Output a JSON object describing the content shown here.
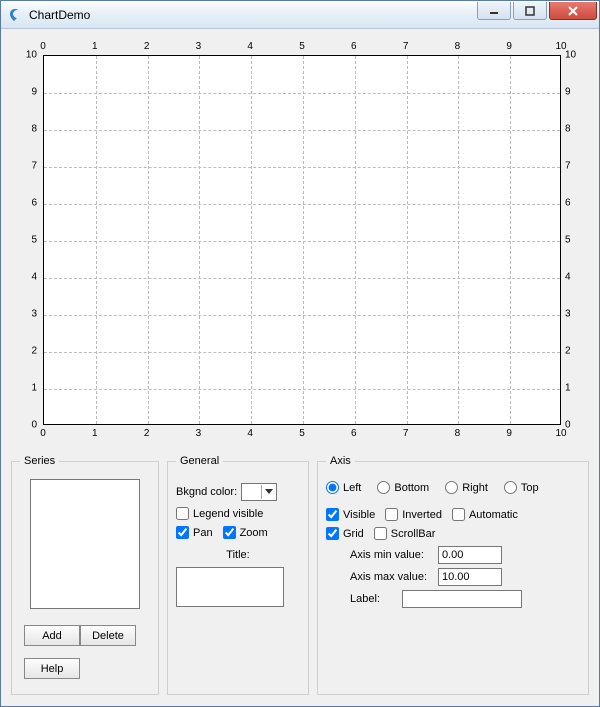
{
  "window": {
    "title": "ChartDemo"
  },
  "chart_data": {
    "type": "scatter",
    "series": [],
    "title": "",
    "xlabel": "",
    "ylabel": "",
    "xlim": [
      0,
      10
    ],
    "ylim": [
      0,
      10
    ],
    "xticks": [
      0,
      1,
      2,
      3,
      4,
      5,
      6,
      7,
      8,
      9,
      10
    ],
    "yticks": [
      0,
      1,
      2,
      3,
      4,
      5,
      6,
      7,
      8,
      9,
      10
    ],
    "grid": true,
    "axes": {
      "left": {
        "visible": true,
        "ticks": [
          0,
          1,
          2,
          3,
          4,
          5,
          6,
          7,
          8,
          9,
          10
        ]
      },
      "right": {
        "visible": true,
        "ticks": [
          0,
          1,
          2,
          3,
          4,
          5,
          6,
          7,
          8,
          9,
          10
        ]
      },
      "top": {
        "visible": true,
        "ticks": [
          0,
          1,
          2,
          3,
          4,
          5,
          6,
          7,
          8,
          9,
          10
        ]
      },
      "bottom": {
        "visible": true,
        "ticks": [
          0,
          1,
          2,
          3,
          4,
          5,
          6,
          7,
          8,
          9,
          10
        ]
      }
    }
  },
  "series_panel": {
    "legend": "Series",
    "items": [],
    "buttons": {
      "add": "Add",
      "delete": "Delete",
      "help": "Help"
    }
  },
  "general_panel": {
    "legend": "General",
    "bkgnd_label": "Bkgnd color:",
    "bkgnd_color": "#f0f0f0",
    "legend_visible_label": "Legend visible",
    "legend_visible": false,
    "pan_label": "Pan",
    "pan": true,
    "zoom_label": "Zoom",
    "zoom": true,
    "title_label": "Title:",
    "title_value": ""
  },
  "axis_panel": {
    "legend": "Axis",
    "selected": "Left",
    "options": {
      "left": "Left",
      "bottom": "Bottom",
      "right": "Right",
      "top": "Top"
    },
    "visible_label": "Visible",
    "visible": true,
    "inverted_label": "Inverted",
    "inverted": false,
    "automatic_label": "Automatic",
    "automatic": false,
    "grid_label": "Grid",
    "grid": true,
    "scrollbar_label": "ScrollBar",
    "scrollbar": false,
    "min_label": "Axis min value:",
    "min_value": "0.00",
    "max_label": "Axis max value:",
    "max_value": "10.00",
    "label_label": "Label:",
    "label_value": ""
  }
}
